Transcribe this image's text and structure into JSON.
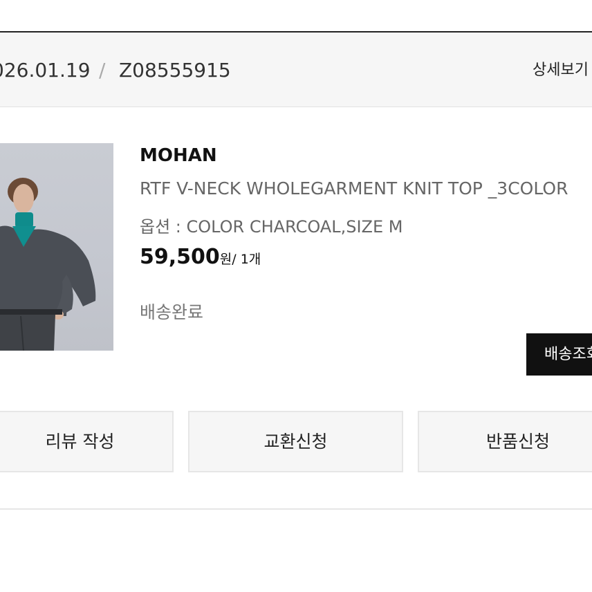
{
  "order": {
    "date": "026.01.19",
    "separator": "/",
    "number": "Z08555915",
    "detail_link": "상세보기"
  },
  "product": {
    "brand": "MOHAN",
    "name": "RTF V-NECK WHOLEGARMENT KNIT TOP _3COLOR",
    "option": "옵션 : COLOR CHARCOAL,SIZE M",
    "price": "59,500",
    "currency": "원",
    "quantity": "/ 1개",
    "status": "배송완료",
    "track_button": "배송조회"
  },
  "actions": {
    "review": "리뷰 작성",
    "exchange": "교환신청",
    "return": "반품신청"
  },
  "colors": {
    "header_bg": "#f6f6f6",
    "button_bg": "#f6f6f6",
    "track_button_bg": "#111111",
    "sweater": "#4a4e55",
    "turtleneck": "#0f8c8c"
  },
  "icons": {
    "product_photo": "product-photo"
  }
}
